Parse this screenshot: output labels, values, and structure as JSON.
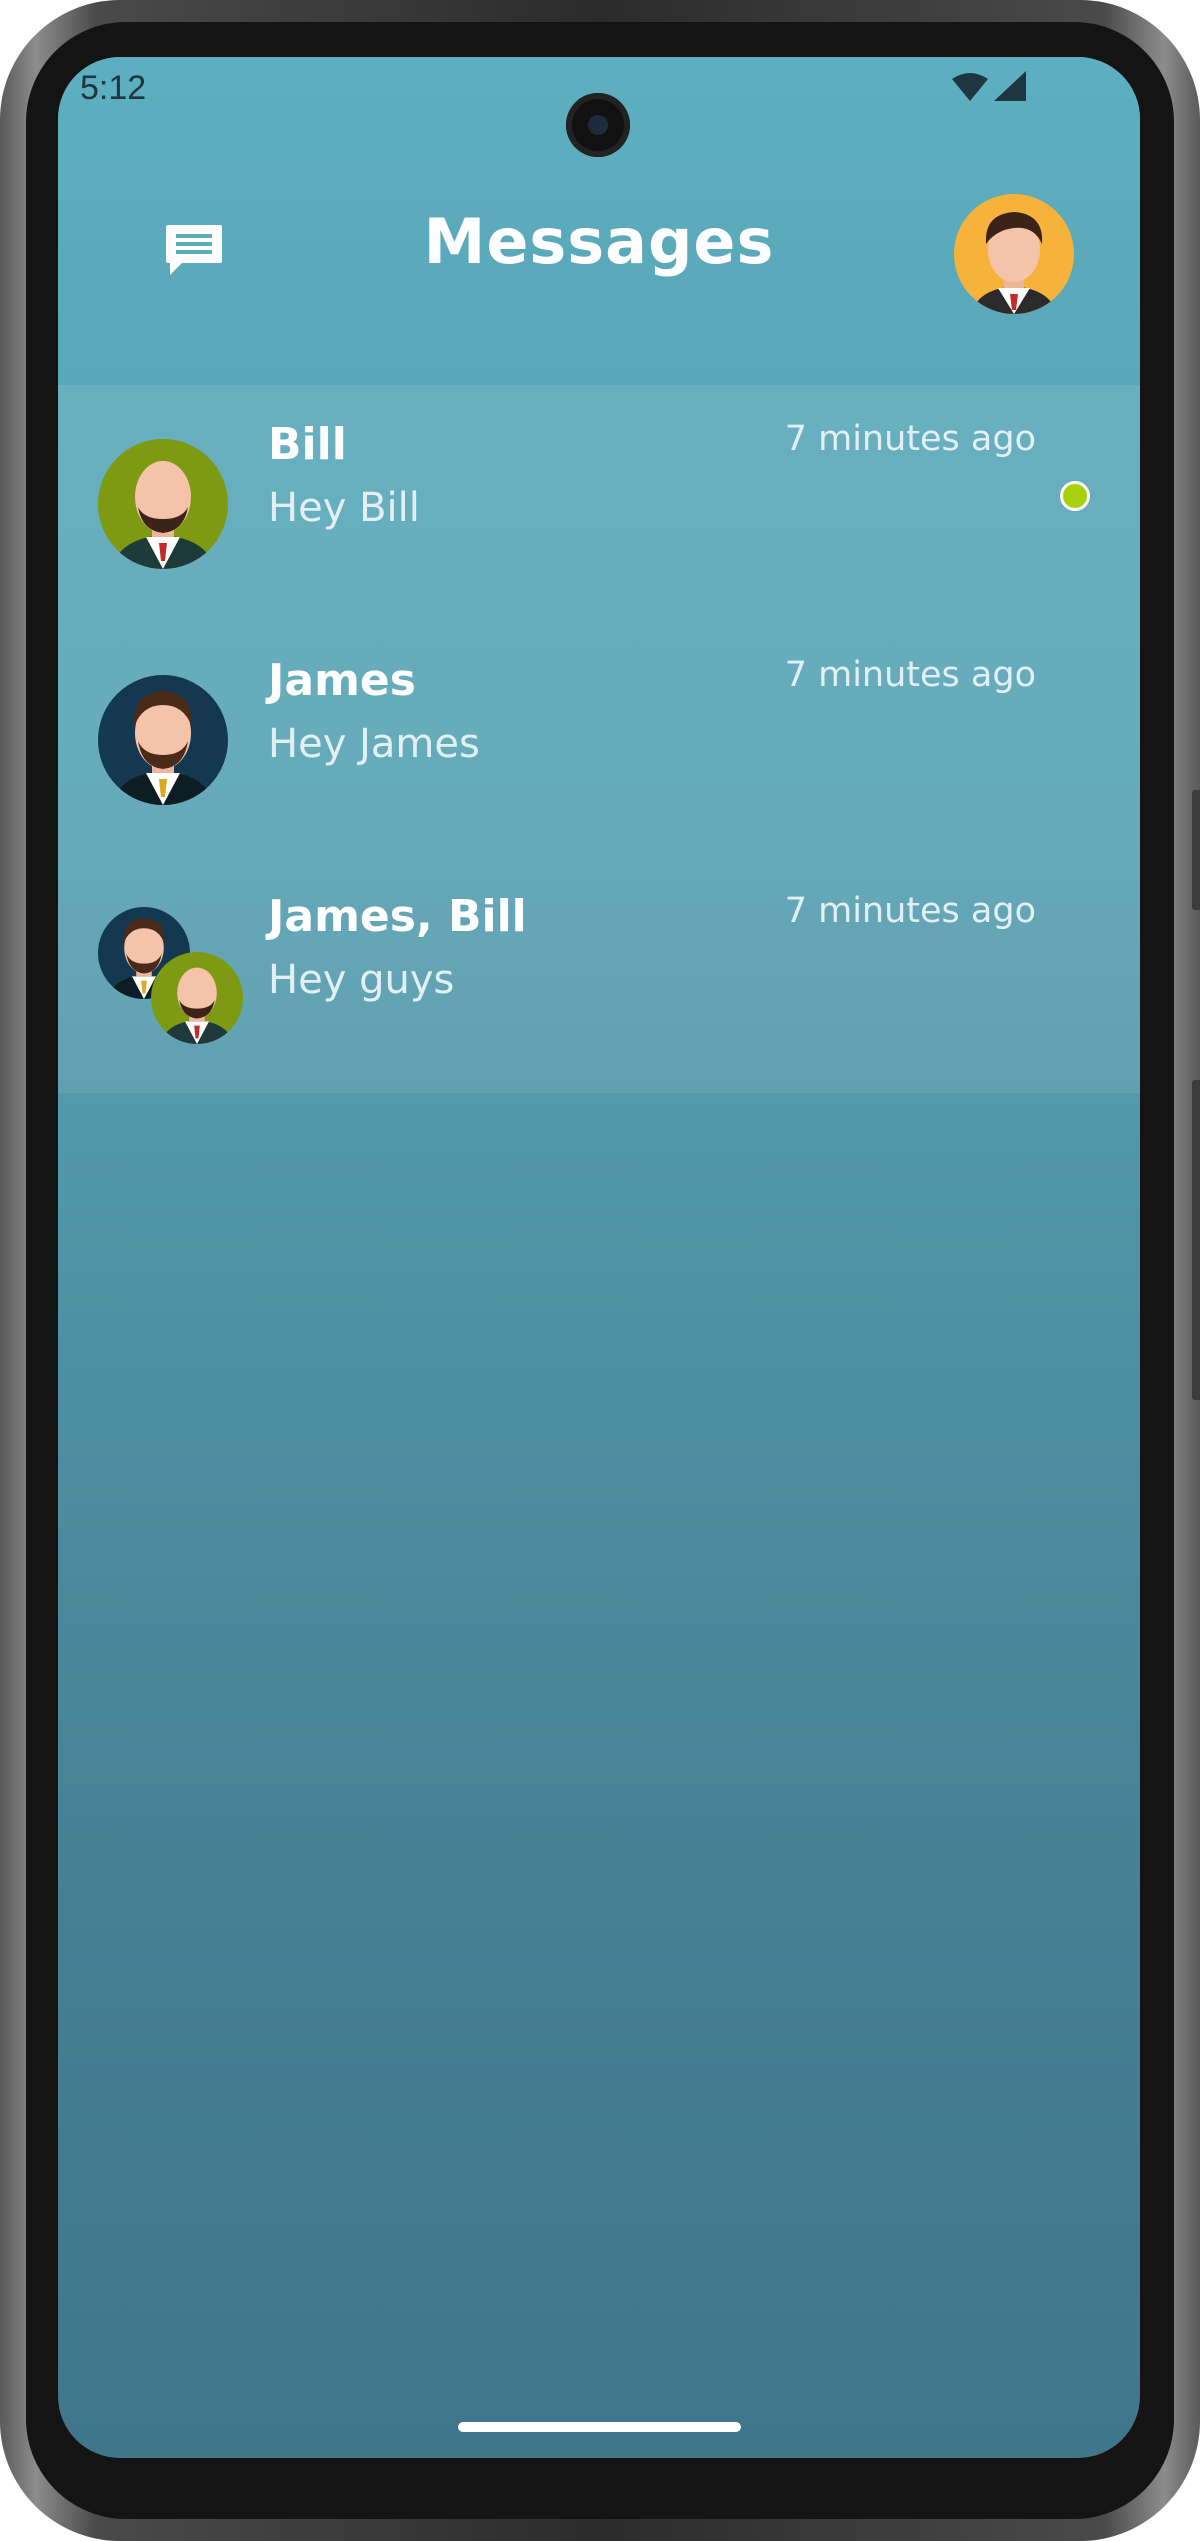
{
  "status_bar": {
    "time": "5:12"
  },
  "header": {
    "title": "Messages",
    "chat_icon": "chat-bubble-icon",
    "profile_avatar": "user-avatar"
  },
  "conversations": [
    {
      "name": "Bill",
      "preview": "Hey Bill",
      "time": "7 minutes ago",
      "unread": true,
      "avatar": "bill-avatar"
    },
    {
      "name": "James",
      "preview": "Hey James",
      "time": "7 minutes ago",
      "unread": false,
      "avatar": "james-avatar"
    },
    {
      "name": "James, Bill",
      "preview": "Hey guys",
      "time": "7 minutes ago",
      "unread": false,
      "avatar": "group-avatar"
    }
  ],
  "colors": {
    "header": "#5dafc0",
    "background_bottom": "#3f768b",
    "unread_dot": "#a8d00c",
    "bill_avatar_bg": "#7d9a12",
    "james_avatar_bg": "#14384f",
    "profile_avatar_bg": "#f6b23a"
  }
}
